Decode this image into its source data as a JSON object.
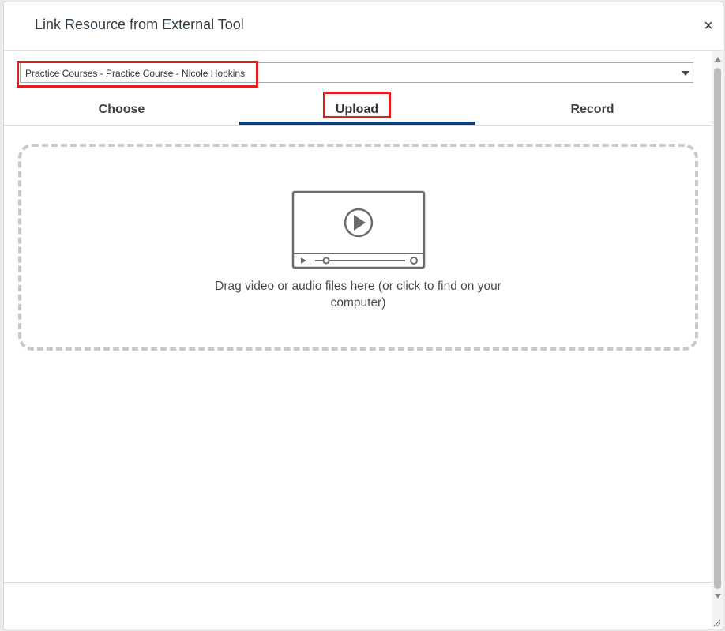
{
  "dialog": {
    "title": "Link Resource from External Tool",
    "close_label": "×"
  },
  "course_select": {
    "value": "Practice Courses - Practice Course - Nicole Hopkins"
  },
  "tabs": [
    {
      "label": "Choose",
      "active": false
    },
    {
      "label": "Upload",
      "active": true
    },
    {
      "label": "Record",
      "active": false
    }
  ],
  "dropzone": {
    "text": "Drag video or audio files here (or click to find on your computer)",
    "icon": "video-player-icon"
  },
  "colors": {
    "accent": "#0b3f7f",
    "highlight": "#e02020",
    "dashed_border": "#c9c9c9"
  }
}
